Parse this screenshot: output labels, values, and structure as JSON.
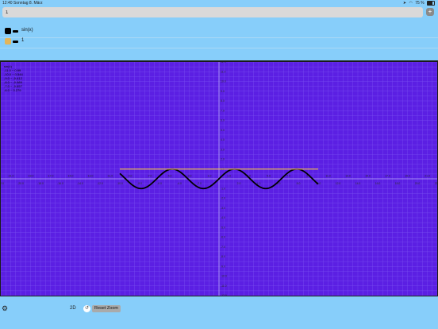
{
  "status": {
    "time": "12:40",
    "date": "Sonntag 8. März",
    "battery": "75 %"
  },
  "input": {
    "value": "1"
  },
  "add_button": {
    "label": "+"
  },
  "functions": [
    {
      "expression": "sin(x)",
      "color": "#000000"
    },
    {
      "expression": "1",
      "color": "#e3b55a"
    }
  ],
  "tooltip": [
    "sin(x)",
    "-11.0 ~ 0.99",
    "-10.0 ~ 0.544",
    "-9.0 ~ -0.412",
    "-8.0 ~ -0.989",
    "-7.0 ~ -0.657",
    "-6.0 ~ 0.279"
  ],
  "toolbar": {
    "mode_label": "2D",
    "reset_icon": "↺",
    "reset_label": "Reset Zoom"
  },
  "colors": {
    "plot_background": "#5b1fe3",
    "grid": "#7a4ff0",
    "axis": "#b8a8f8",
    "sin_curve": "#000000",
    "constant_line": "#e3b55a"
  },
  "chart_data": {
    "type": "line",
    "xlim": [
      -22,
      22
    ],
    "ylim": [
      -12,
      12
    ],
    "grid": true,
    "x_ticks": [
      -22,
      -21,
      -20,
      -19,
      -18,
      -17,
      -16,
      -15,
      -14,
      -13,
      -12,
      -11,
      -10,
      -9,
      -8,
      -7,
      -6,
      -5,
      -4,
      -3,
      -2,
      -1,
      0,
      1,
      2,
      3,
      4,
      5,
      6,
      7,
      8,
      9,
      10,
      11,
      12,
      13,
      14,
      15,
      16,
      17,
      18,
      19,
      20,
      21,
      22
    ],
    "y_ticks": [
      -12,
      -11,
      -10,
      -9,
      -8,
      -7,
      -6,
      -5,
      -4,
      -3,
      -2,
      -1,
      0,
      1,
      2,
      3,
      4,
      5,
      6,
      7,
      8,
      9,
      10,
      11,
      12
    ],
    "series": [
      {
        "name": "sin(x)",
        "function": "sin",
        "domain": [
          -10,
          10
        ]
      },
      {
        "name": "1",
        "function": "const",
        "value": 1,
        "domain": [
          -10,
          10
        ]
      }
    ]
  }
}
